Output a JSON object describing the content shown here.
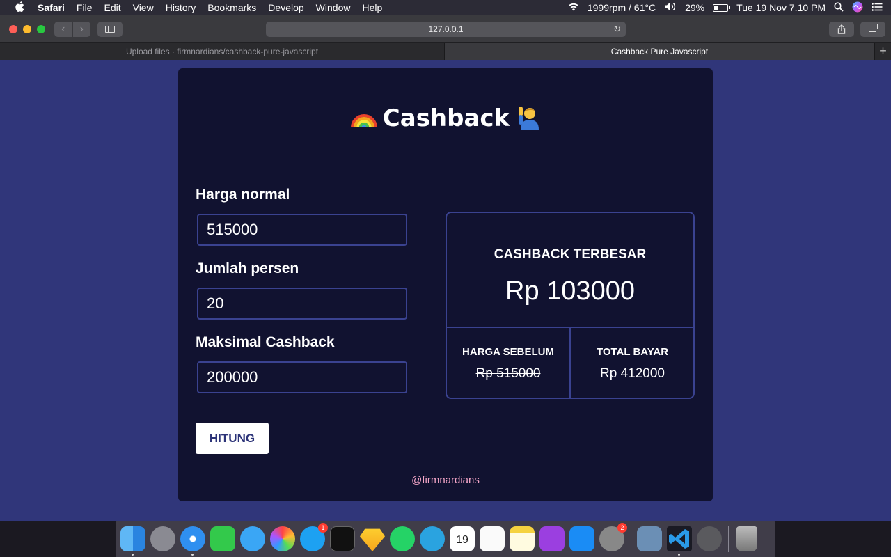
{
  "menubar": {
    "app": "Safari",
    "items": [
      "File",
      "Edit",
      "View",
      "History",
      "Bookmarks",
      "Develop",
      "Window",
      "Help"
    ],
    "status": {
      "fan": "1999rpm / 61°C",
      "battery_percent": "29%",
      "battery_level": 0.29,
      "datetime": "Tue 19 Nov  7.10 PM"
    }
  },
  "browser": {
    "url": "127.0.0.1",
    "tabs": [
      {
        "title": "Upload files · firmnardians/cashback-pure-javascript",
        "active": false
      },
      {
        "title": "Cashback Pure Javascript",
        "active": true
      }
    ]
  },
  "app": {
    "title": "Cashback",
    "fields": {
      "harga_label": "Harga normal",
      "harga_value": "515000",
      "persen_label": "Jumlah persen",
      "persen_value": "20",
      "maks_label": "Maksimal Cashback",
      "maks_value": "200000"
    },
    "button": "HITUNG",
    "result": {
      "cashback_caption": "CASHBACK TERBESAR",
      "cashback_value": "Rp 103000",
      "sebelum_caption": "HARGA SEBELUM",
      "sebelum_value": "Rp 515000",
      "total_caption": "TOTAL BAYAR",
      "total_value": "Rp 412000"
    },
    "footer": "@firmnardians"
  },
  "dock": {
    "badges": {
      "twitter": "1",
      "settings": "2"
    },
    "calendar": {
      "month": "NOV",
      "day": "19"
    }
  },
  "colors": {
    "page_bg": "#30367a",
    "card_bg": "#111230",
    "border": "#3a4290",
    "footer_text": "#f5a6c8",
    "button_text": "#2c3378"
  }
}
